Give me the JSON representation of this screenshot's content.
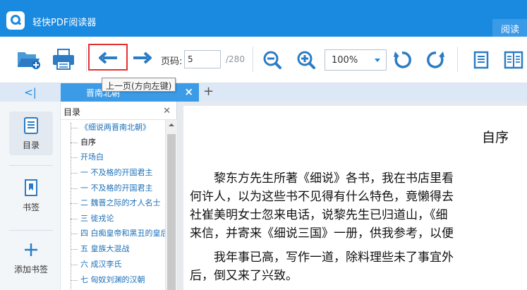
{
  "app": {
    "title": "轻快PDF阅读器",
    "mode_tab": "阅读"
  },
  "toolbar": {
    "page_label": "页码:",
    "page_value": "5",
    "page_total": "/280",
    "zoom_value": "100%",
    "prev_tooltip": "上一页(方向左键)"
  },
  "tabs": {
    "collapse_symbol": "<|",
    "doc_tab_label": "晋南北朝",
    "new_tab": "+"
  },
  "sidebar": {
    "items": [
      {
        "label": "目录",
        "icon": "toc-icon"
      },
      {
        "label": "书签",
        "icon": "bookmark-icon"
      },
      {
        "label": "添加书签",
        "icon": "add-bookmark-icon"
      }
    ]
  },
  "toc": {
    "title": "目录",
    "items": [
      "《细说两晋南北朝》",
      "自序",
      "开场白",
      "一 不及格的开国君主",
      "一 不及格的开国君主",
      "二 魏晋之际的才人名士",
      "三 徙戎论",
      "四 白痴皇帝和黑丑的皇后",
      "五 皇族大混战",
      "六 成汉李氏",
      "七 匈奴刘渊的汉朝"
    ],
    "selected_index": 1
  },
  "document": {
    "heading": "自序",
    "lines": [
      "　　黎东方先生所著《细说》各书，我在书店里看",
      "何许人，以为这些书不见得有什么特色，竟懒得去",
      "社崔美明女士忽来电话，说黎先生已归道山，《细",
      "来信，并寄来《细说三国》一册，供我参考，以便",
      "　　我年事已高，写作一道，除料理些未了事宜外",
      "后，倒又来了兴致。"
    ]
  },
  "colors": {
    "brand": "#1a8ae0",
    "tab_active": "#3c9be7",
    "highlight": "#e53030"
  }
}
